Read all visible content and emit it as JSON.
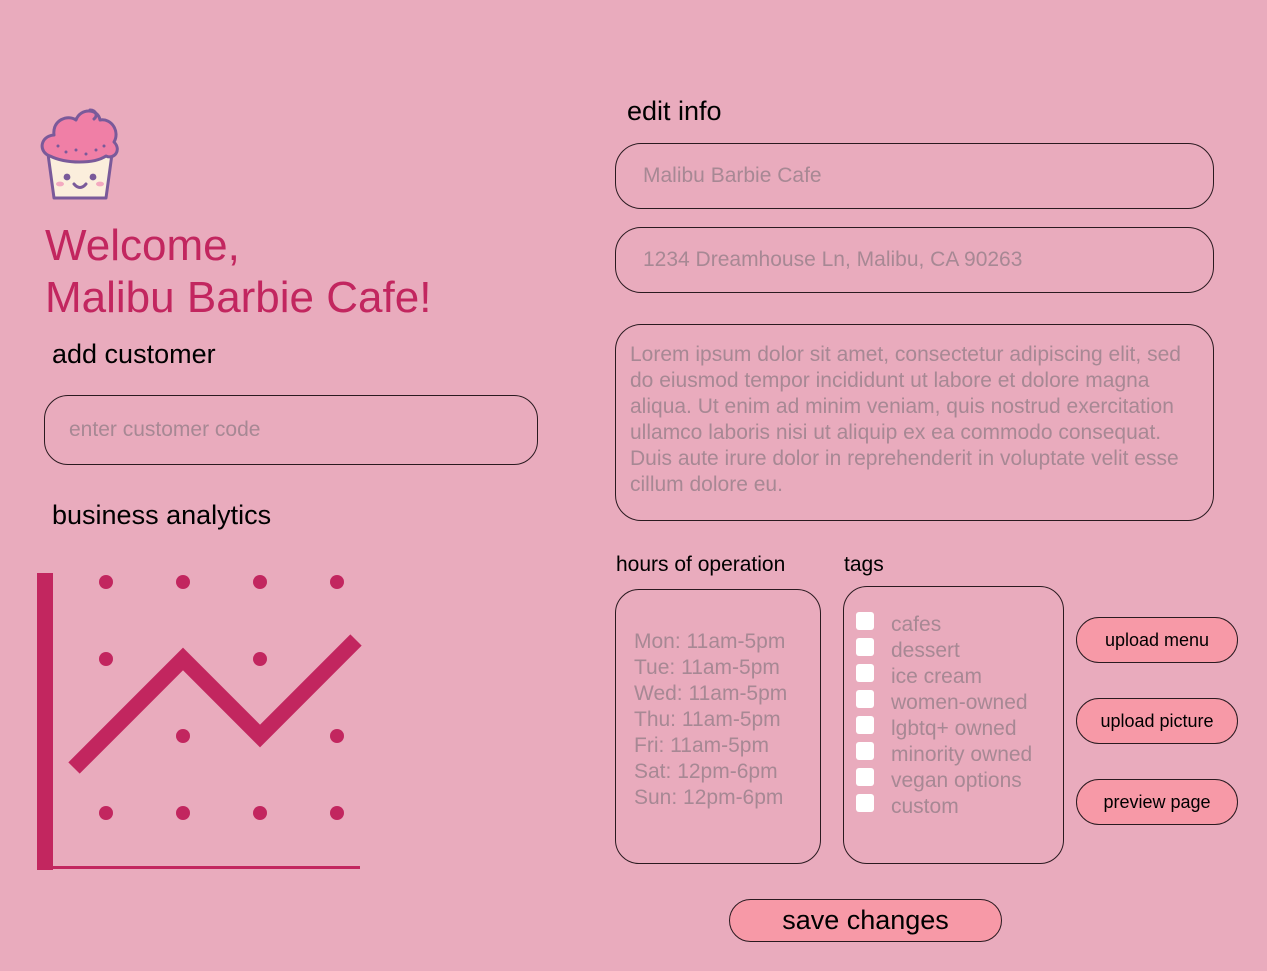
{
  "header": {
    "logo_icon": "cupcake-icon",
    "welcome_line1": "Welcome,",
    "welcome_line2": "Malibu Barbie Cafe!"
  },
  "add_customer": {
    "label": "add customer",
    "placeholder": "enter customer code"
  },
  "analytics": {
    "label": "business analytics",
    "icon": "line-chart-icon"
  },
  "edit_info": {
    "label": "edit info",
    "name_placeholder": "Malibu Barbie Cafe",
    "address_placeholder": "1234 Dreamhouse Ln, Malibu, CA 90263",
    "description_placeholder": "Lorem ipsum dolor sit amet, consectetur adipiscing elit, sed do eiusmod tempor incididunt ut labore et dolore magna aliqua. Ut enim ad minim veniam, quis nostrud exercitation ullamco laboris nisi ut aliquip ex ea commodo consequat. Duis aute irure dolor in reprehenderit in voluptate velit esse cillum dolore eu."
  },
  "hours": {
    "label": "hours of operation",
    "lines": [
      "Mon: 11am-5pm",
      "Tue: 11am-5pm",
      "Wed: 11am-5pm",
      "Thu: 11am-5pm",
      "Fri: 11am-5pm",
      "Sat: 12pm-6pm",
      "Sun: 12pm-6pm"
    ]
  },
  "tags": {
    "label": "tags",
    "items": [
      "cafes",
      "dessert",
      "ice cream",
      "women-owned",
      "lgbtq+ owned",
      "minority owned",
      "vegan options",
      "custom"
    ]
  },
  "actions": {
    "upload_menu": "upload menu",
    "upload_picture": "upload picture",
    "preview_page": "preview page",
    "save": "save changes"
  },
  "colors": {
    "background": "#e9abbd",
    "accent": "#c2265f",
    "button": "#f799a7",
    "placeholder_text": "#a78894"
  }
}
